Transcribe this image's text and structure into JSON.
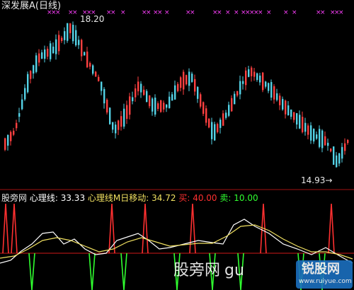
{
  "price_panel": {
    "title": "深发展A",
    "period": "(日线)",
    "high_label": "18.20",
    "low_label": "14.93",
    "low_arrow": "→",
    "top_marker": "×"
  },
  "indicator_panel": {
    "name": "股旁网",
    "line1_label": "心理线:",
    "line1_value": "33.33",
    "line2_label": "心理线M日移动:",
    "line2_value": "34.72",
    "buy_label": "买:",
    "buy_value": "40.00",
    "sell_label": "卖:",
    "sell_value": "10.00"
  },
  "watermark": {
    "site_text": "股旁网",
    "url_part": "gu",
    "logo_cn": "锐股网",
    "logo_url": "www.ruiyue.com"
  },
  "colors": {
    "background": "#000000",
    "up_candle": "#ff4040",
    "down_candle": "#54d2e6",
    "panel_border": "#a01010",
    "title_text": "#e8e8e8",
    "line1": "#ffffff",
    "line2": "#f0e060",
    "buy": "#ff3030",
    "sell": "#30ff30",
    "marker": "#ff40ff"
  },
  "chart_data": {
    "type": "candlestick",
    "price_high": 18.2,
    "price_low": 14.93
  }
}
